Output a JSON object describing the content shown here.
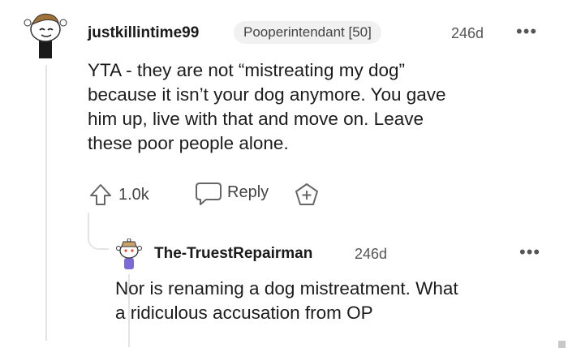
{
  "comment": {
    "username": "justkillintime99",
    "flair": "Pooperintendant [50]",
    "age": "246d",
    "more_icon": "more-horizontal-icon",
    "body_lines": [
      "YTA - they are not “mistreating my dog”",
      "because it isn’t your dog anymore. You gave",
      "him up, live with that and move on. Leave",
      "these poor people alone."
    ],
    "upvote_icon": "upvote-arrow-icon",
    "score": "1.0k",
    "reply_icon": "chat-bubble-icon",
    "reply_label": "Reply",
    "award_icon": "add-award-icon"
  },
  "reply": {
    "username": "The-TruestRepairman",
    "age": "246d",
    "more_icon": "more-horizontal-icon",
    "body_lines": [
      "Nor is renaming a dog mistreatment. What",
      "a ridiculous accusation from OP"
    ]
  },
  "colors": {
    "text": "#1c1c1c",
    "meta": "#555555",
    "flair_bg": "#f1f1f1",
    "thread_line": "#e4e4e4"
  }
}
